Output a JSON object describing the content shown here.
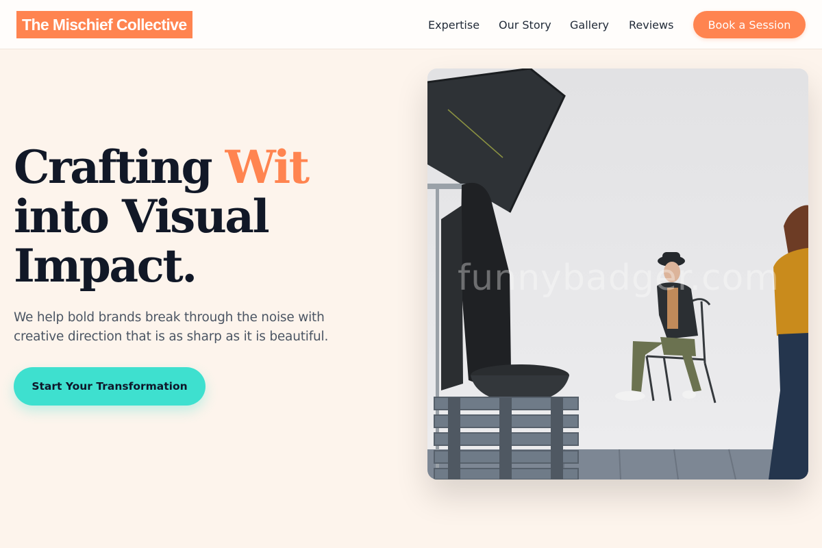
{
  "header": {
    "brand": "The Mischief Collective",
    "nav": [
      "Expertise",
      "Our Story",
      "Gallery",
      "Reviews"
    ],
    "cta_label": "Book a Session"
  },
  "hero": {
    "headline_part1": "Crafting ",
    "headline_accent": "Wit",
    "headline_line2": "into Visual",
    "headline_line3": "Impact.",
    "subtext": "We help bold brands break through the noise with creative direction that is as sharp as it is beautiful.",
    "cta_label": "Start Your Transformation",
    "image_watermark": "funnybadger.com"
  },
  "colors": {
    "brand": "#ff8450",
    "accent_teal": "#3ee0cf",
    "background": "#fdf4ec",
    "heading": "#111827",
    "body_text": "#4b5563"
  }
}
